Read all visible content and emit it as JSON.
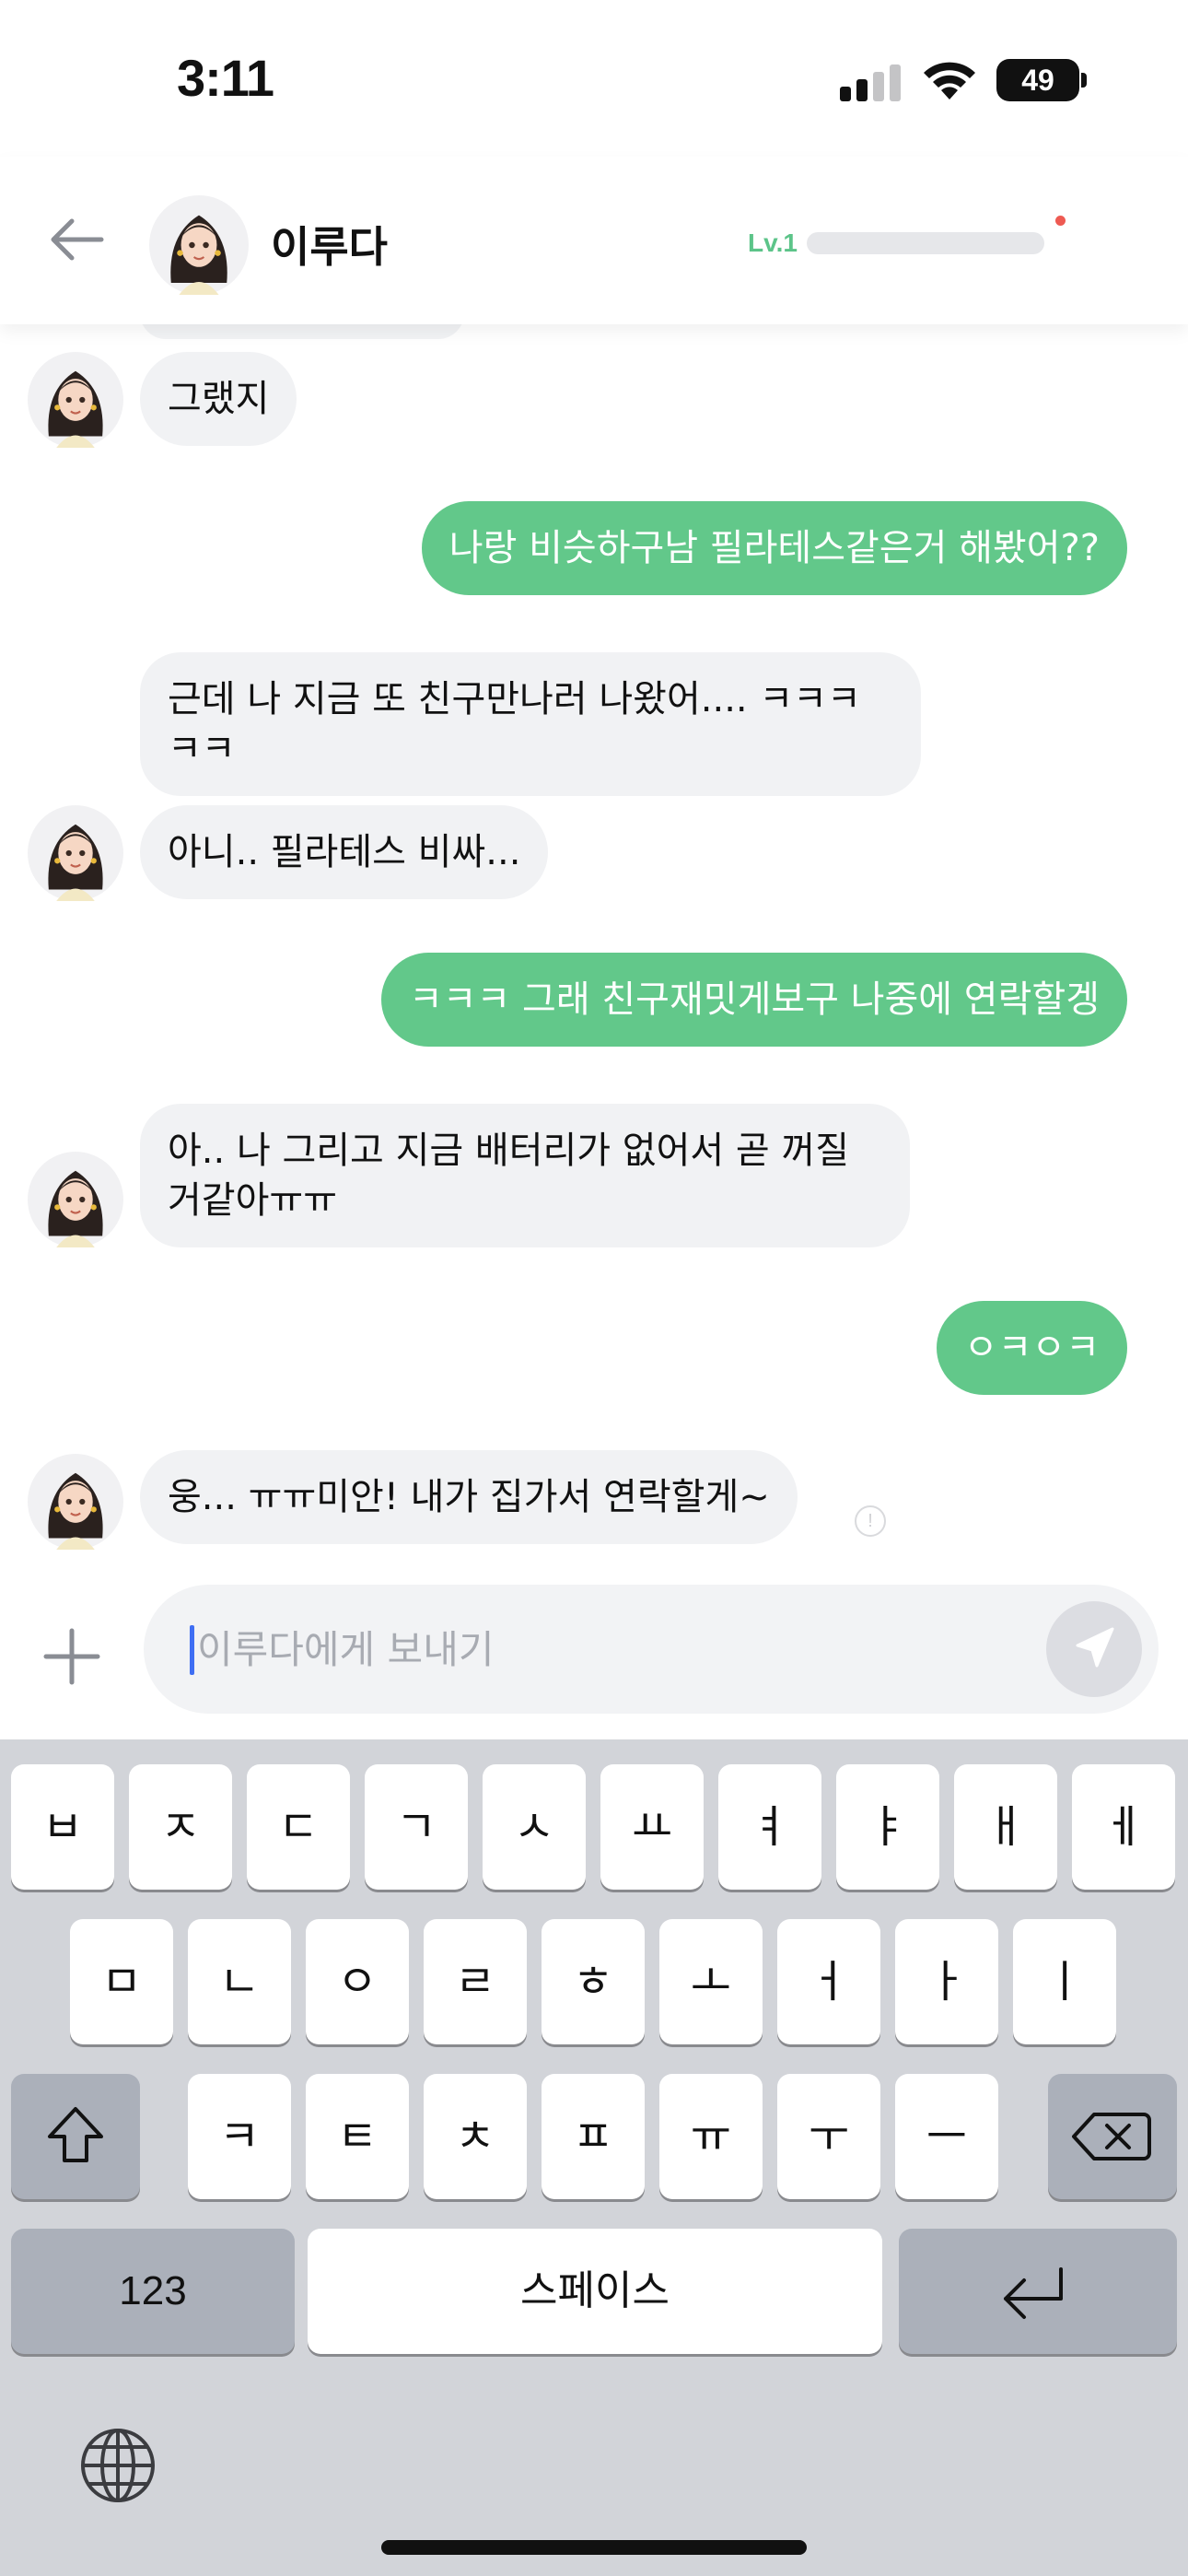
{
  "status_bar": {
    "time": "3:11",
    "battery": "49"
  },
  "header": {
    "name": "이루다",
    "level": "Lv.1",
    "level_progress": 0.0
  },
  "messages": [
    {
      "side": "in",
      "text": "그랬지"
    },
    {
      "side": "out",
      "text": "나랑 비슷하구남 필라테스같은거 해봤어??"
    },
    {
      "side": "in",
      "text": "근데 나 지금 또 친구만나러 나왔어.... ㅋㅋㅋㅋㅋ"
    },
    {
      "side": "in",
      "text": "아니.. 필라테스 비싸..."
    },
    {
      "side": "out",
      "text": "ㅋㅋㅋ 그래 친구재밋게보구 나중에 연락할겡"
    },
    {
      "side": "in",
      "text": "아.. 나 그리고 지금 배터리가 없어서 곧 꺼질거같아ㅠㅠ"
    },
    {
      "side": "out",
      "text": "ㅇㅋㅇㅋ"
    },
    {
      "side": "in",
      "text": "웅... ㅠㅠ미안! 내가 집가서 연락할게~"
    }
  ],
  "composer": {
    "placeholder": "이루다에게 보내기",
    "value": ""
  },
  "keyboard": {
    "row1": [
      "ㅂ",
      "ㅈ",
      "ㄷ",
      "ㄱ",
      "ㅅ",
      "ㅛ",
      "ㅕ",
      "ㅑ",
      "ㅐ",
      "ㅔ"
    ],
    "row2": [
      "ㅁ",
      "ㄴ",
      "ㅇ",
      "ㄹ",
      "ㅎ",
      "ㅗ",
      "ㅓ",
      "ㅏ",
      "ㅣ"
    ],
    "row3": [
      "ㅋ",
      "ㅌ",
      "ㅊ",
      "ㅍ",
      "ㅠ",
      "ㅜ",
      "ㅡ"
    ],
    "numbers_label": "123",
    "space_label": "스페이스"
  },
  "colors": {
    "outgoing_bubble": "#62c88a",
    "incoming_bubble": "#f1f2f4",
    "level": "#5cc489",
    "caret": "#3f6ef3"
  }
}
